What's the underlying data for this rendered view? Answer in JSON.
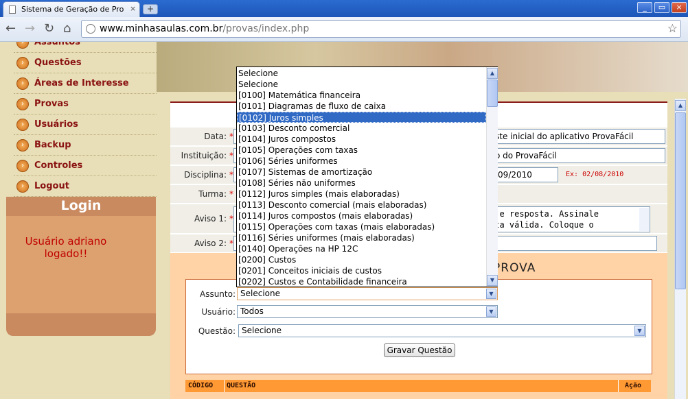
{
  "browser": {
    "tab_title": "Sistema de Geração de Prov...",
    "tab_close": "×",
    "new_tab": "+",
    "window_controls": {
      "minimize": "_",
      "maximize": "▭",
      "close": "×"
    },
    "address_host": "www.minhasaulas.com.br",
    "address_path": "/provas/index.php"
  },
  "sidebar": {
    "items": [
      {
        "label": "Assuntos"
      },
      {
        "label": "Questões"
      },
      {
        "label": "Áreas de Interesse"
      },
      {
        "label": "Provas"
      },
      {
        "label": "Usuários"
      },
      {
        "label": "Backup"
      },
      {
        "label": "Controles"
      },
      {
        "label": "Logout"
      }
    ],
    "login_title": "Login",
    "login_message": "Usuário adriano logado!!"
  },
  "form": {
    "data": {
      "label": "Data:",
      "required": "*",
      "value": "ste inicial do aplicativo ProvaFácil"
    },
    "instituicao": {
      "label": "Instituição:",
      "required": "*",
      "value": "o do ProvaFácil"
    },
    "disciplina": {
      "label": "Disciplina:",
      "required": "*",
      "value": "/09/2010",
      "hint": "Ex: 02/08/2010"
    },
    "turma": {
      "label": "Turma:",
      "required": "*"
    },
    "aviso1": {
      "label": "Aviso 1:",
      "required": "*",
      "value": "o e resposta. Assinale\nsta válida. Coloque o"
    },
    "aviso2": {
      "label": "Aviso 2:",
      "required": "*",
      "value": ""
    }
  },
  "prova": {
    "title": "PROVA",
    "assunto": {
      "label": "Assunto:",
      "value": "Selecione"
    },
    "usuario": {
      "label": "Usuário:",
      "value": "Todos"
    },
    "questao": {
      "label": "Questão:",
      "value": "Selecione"
    },
    "gravar_button": "Gravar Questão",
    "table_headers": {
      "codigo": "CÓDIGO",
      "questao": "QUESTÃO",
      "acao": "Ação"
    }
  },
  "dropdown": {
    "options": [
      "Selecione",
      "Selecione",
      "[0100] Matemática financeira",
      "[0101] Diagramas de fluxo de caixa",
      "[0102] Juros simples",
      "[0103] Desconto comercial",
      "[0104] Juros compostos",
      "[0105] Operações com taxas",
      "[0106] Séries uniformes",
      "[0107] Sistemas de amortização",
      "[0108] Séries não uniformes",
      "[0112] Juros simples (mais elaboradas)",
      "[0113] Desconto comercial (mais elaboradas)",
      "[0114] Juros compostos (mais elaboradas)",
      "[0115] Operações com taxas (mais elaboradas)",
      "[0116] Séries uniformes (mais elaboradas)",
      "[0140] Operações na HP 12C",
      "[0200] Custos",
      "[0201] Conceitos iniciais de custos",
      "[0202] Custos e Contabilidade financeira"
    ],
    "highlighted_index": 4
  },
  "colors": {
    "accent": "#316ac5",
    "nav_text": "#8a1212",
    "login_msg": "#c00000",
    "table_header": "#ff9933"
  }
}
